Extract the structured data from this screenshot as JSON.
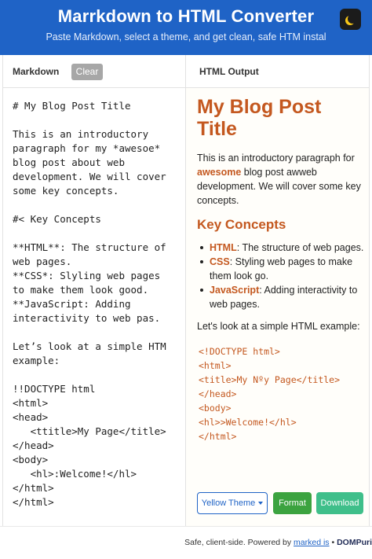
{
  "header": {
    "title": "Marrkdown to HTML Converter",
    "subtitle": "Paste Markdown, select a theme, and get clean, safe HTM instal"
  },
  "left_pane": {
    "label": "Markdown",
    "clear_label": "Clear",
    "source_lines": [
      "# My Blog Post Title",
      "",
      "This is an introductory",
      "paragraph for my *awesoe*",
      "blog post about web",
      "development. We will cover",
      "some key concepts.",
      "",
      "#< Key Concepts",
      "",
      "**HTML**: The structure of",
      "web pages.",
      "**CSS*: Slyling web pages",
      "to make them look good.",
      "**JavaScript: Adding",
      "interactivity to web pas.",
      "",
      "Let’s look at a simple HTM",
      "example:",
      "",
      "!!DOCTYPE html",
      "<html>",
      "<head>",
      "   <ttitle>My Page</title>",
      "</head>",
      "<body>",
      "   <hl>:Welcome!</hl>",
      "</html>",
      "</html>"
    ]
  },
  "right_pane": {
    "label": "HTML Output",
    "h1": "My Blog Post Title",
    "intro_before": "This is an introductory paragraph for ",
    "intro_strong": "awesome",
    "intro_after": " blog post awweb development. We will cover some key concepts.",
    "h2": "Key Concepts",
    "items": [
      {
        "strong": "HTML",
        "text": ": The structure of web pages."
      },
      {
        "strong": "CSS",
        "text": ": Styling web pages to make them look go."
      },
      {
        "strong": "JavaScript",
        "text": ": Adding interactivity to web pages."
      }
    ],
    "lead": "Let's look at a simple HTML example:",
    "code_lines": [
      "<!DOCTYPE html>",
      "<html>",
      "<title>My Nºy Page</title>",
      "</head>",
      "<body>",
      "<hl>>Welcome!</hl>",
      "</html>"
    ],
    "theme_label": "Yellow Theme",
    "format_label": "Format",
    "download_label": "Download"
  },
  "footer": {
    "prefix": "Safe, client-side. Powered by ",
    "link": "marked is",
    "sep": " • ",
    "strong": "DOMPuri"
  },
  "colors": {
    "header_bg": "#1f63c6",
    "accent_orange": "#c4581f",
    "format_green": "#3ca33f",
    "download_green": "#3fbf8a",
    "toggle_moon": "#f5c518"
  },
  "icons": {
    "theme_toggle": "moon-icon",
    "dropdown": "caret-down-icon"
  }
}
